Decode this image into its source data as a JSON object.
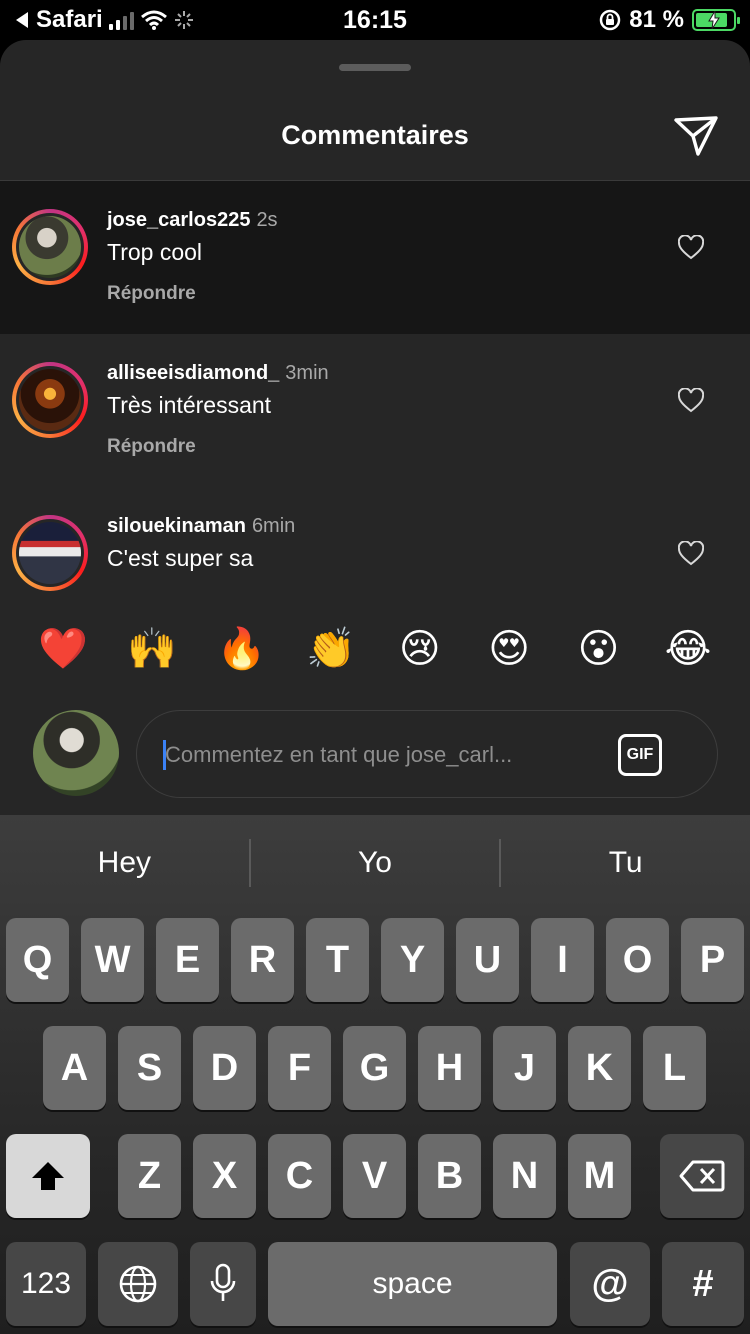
{
  "status_bar": {
    "back_app": "Safari",
    "time": "16:15",
    "battery_percent": "81 %",
    "battery_level": 0.81
  },
  "sheet": {
    "title": "Commentaires"
  },
  "comments": [
    {
      "username": "jose_carlos225",
      "time": "2s",
      "text": "Trop cool",
      "reply_label": "Répondre"
    },
    {
      "username": "alliseeisdiamond_",
      "time": "3min",
      "text": "Très intéressant",
      "reply_label": "Répondre"
    },
    {
      "username": "silouekinaman",
      "time": "6min",
      "text": "C'est super sa",
      "reply_label": ""
    }
  ],
  "emoji_reactions": [
    "❤️",
    "🙌",
    "🔥",
    "👏",
    "😢",
    "😍",
    "😮",
    "😂"
  ],
  "comment_input": {
    "placeholder": "Commentez en tant que jose_carl...",
    "gif_label": "GIF"
  },
  "keyboard": {
    "suggestions": [
      "Hey",
      "Yo",
      "Tu"
    ],
    "row1": [
      "Q",
      "W",
      "E",
      "R",
      "T",
      "Y",
      "U",
      "I",
      "O",
      "P"
    ],
    "row2": [
      "A",
      "S",
      "D",
      "F",
      "G",
      "H",
      "J",
      "K",
      "L"
    ],
    "row3": [
      "Z",
      "X",
      "C",
      "V",
      "B",
      "N",
      "M"
    ],
    "numbers_key": "123",
    "space_key": "space",
    "at_key": "@",
    "hash_key": "#"
  }
}
